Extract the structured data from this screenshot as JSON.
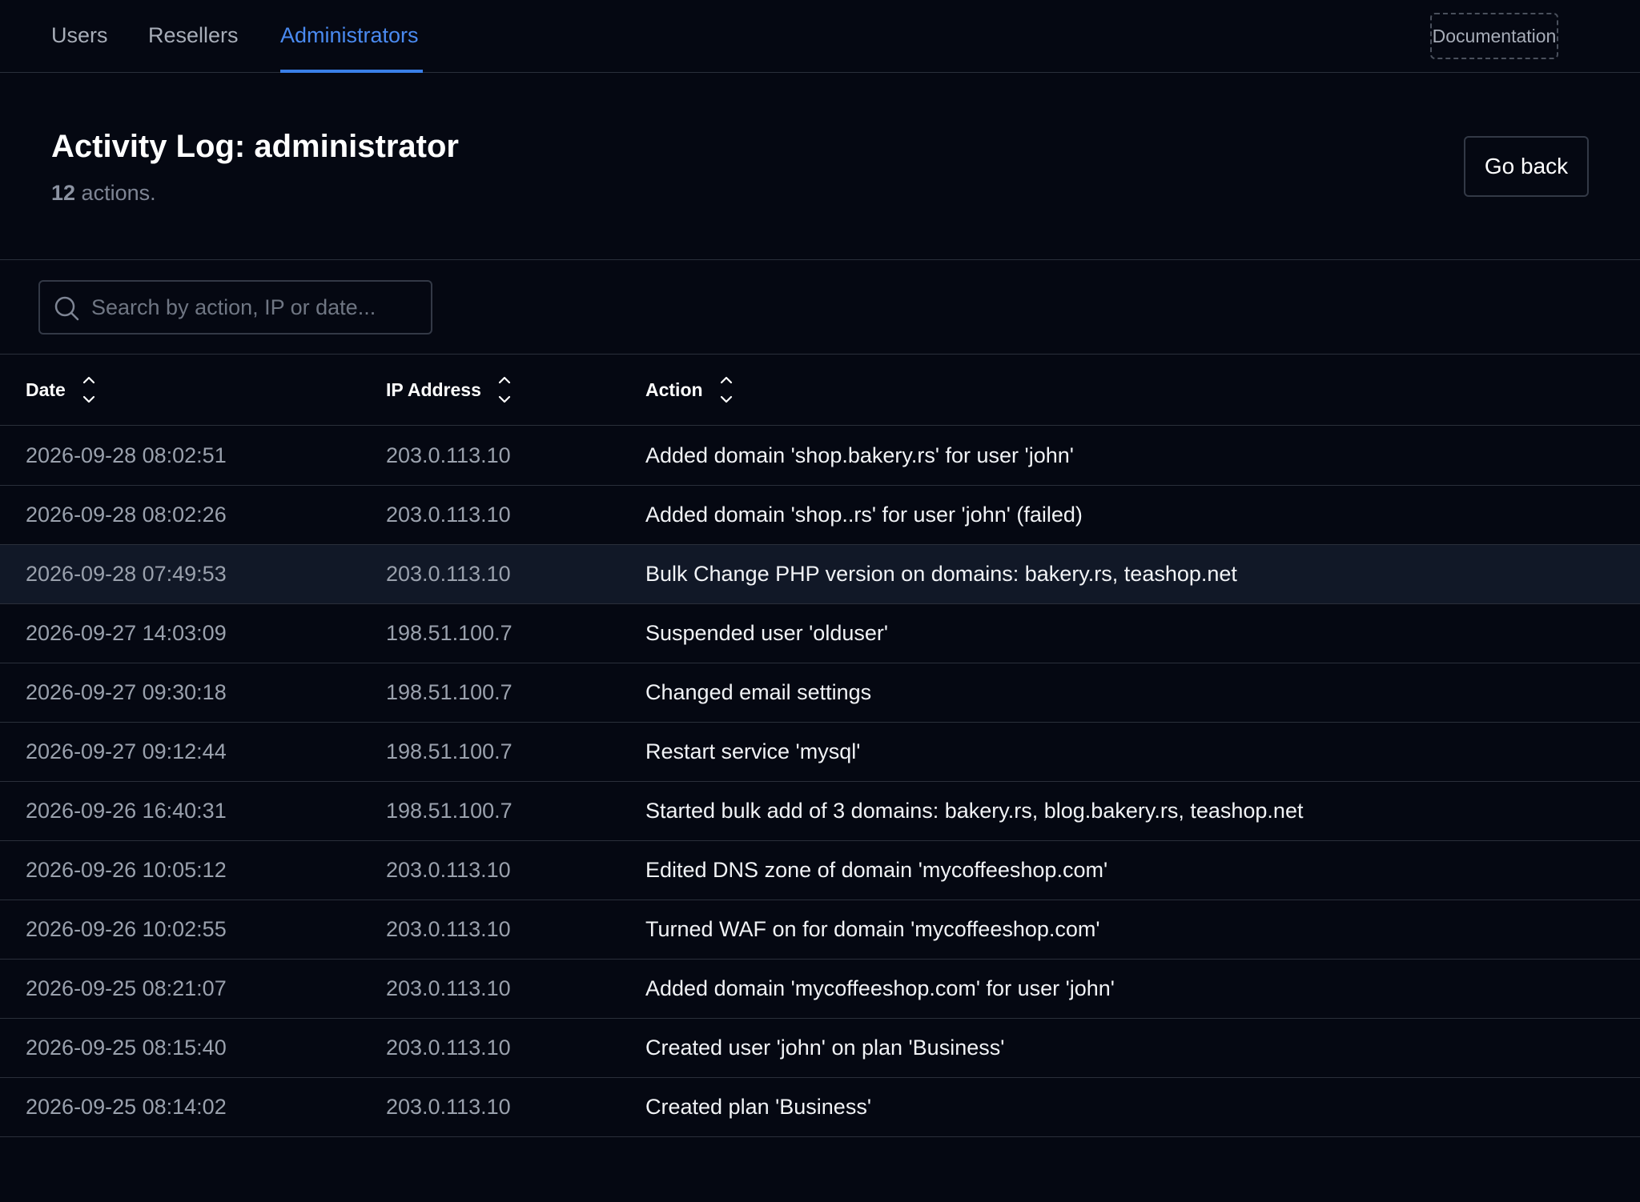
{
  "nav": {
    "tabs": [
      {
        "label": "Users"
      },
      {
        "label": "Resellers"
      },
      {
        "label": "Administrators",
        "active": true
      }
    ],
    "documentation_label": "Documentation",
    "accent_color": "#4a8af0"
  },
  "header": {
    "title": "Activity Log: administrator",
    "count": "12",
    "count_suffix": " actions.",
    "go_back_label": "Go back"
  },
  "search": {
    "placeholder": "Search by action, IP or date...",
    "value": ""
  },
  "table": {
    "columns": [
      "Date",
      "IP Address",
      "Action"
    ],
    "highlighted_row": 2,
    "rows": [
      {
        "date": "2026-09-28 08:02:51",
        "ip": "203.0.113.10",
        "action": "Added domain 'shop.bakery.rs' for user 'john'"
      },
      {
        "date": "2026-09-28 08:02:26",
        "ip": "203.0.113.10",
        "action": "Added domain 'shop..rs' for user 'john' (failed)"
      },
      {
        "date": "2026-09-28 07:49:53",
        "ip": "203.0.113.10",
        "action": "Bulk Change PHP version on domains: bakery.rs, teashop.net"
      },
      {
        "date": "2026-09-27 14:03:09",
        "ip": "198.51.100.7",
        "action": "Suspended user 'olduser'"
      },
      {
        "date": "2026-09-27 09:30:18",
        "ip": "198.51.100.7",
        "action": "Changed email settings"
      },
      {
        "date": "2026-09-27 09:12:44",
        "ip": "198.51.100.7",
        "action": "Restart service 'mysql'"
      },
      {
        "date": "2026-09-26 16:40:31",
        "ip": "198.51.100.7",
        "action": "Started bulk add of 3 domains: bakery.rs, blog.bakery.rs, teashop.net"
      },
      {
        "date": "2026-09-26 10:05:12",
        "ip": "203.0.113.10",
        "action": "Edited DNS zone of domain 'mycoffeeshop.com'"
      },
      {
        "date": "2026-09-26 10:02:55",
        "ip": "203.0.113.10",
        "action": "Turned WAF on for domain 'mycoffeeshop.com'"
      },
      {
        "date": "2026-09-25 08:21:07",
        "ip": "203.0.113.10",
        "action": "Added domain 'mycoffeeshop.com' for user 'john'"
      },
      {
        "date": "2026-09-25 08:15:40",
        "ip": "203.0.113.10",
        "action": "Created user 'john' on plan 'Business'"
      },
      {
        "date": "2026-09-25 08:14:02",
        "ip": "203.0.113.10",
        "action": "Created plan 'Business'"
      }
    ]
  }
}
